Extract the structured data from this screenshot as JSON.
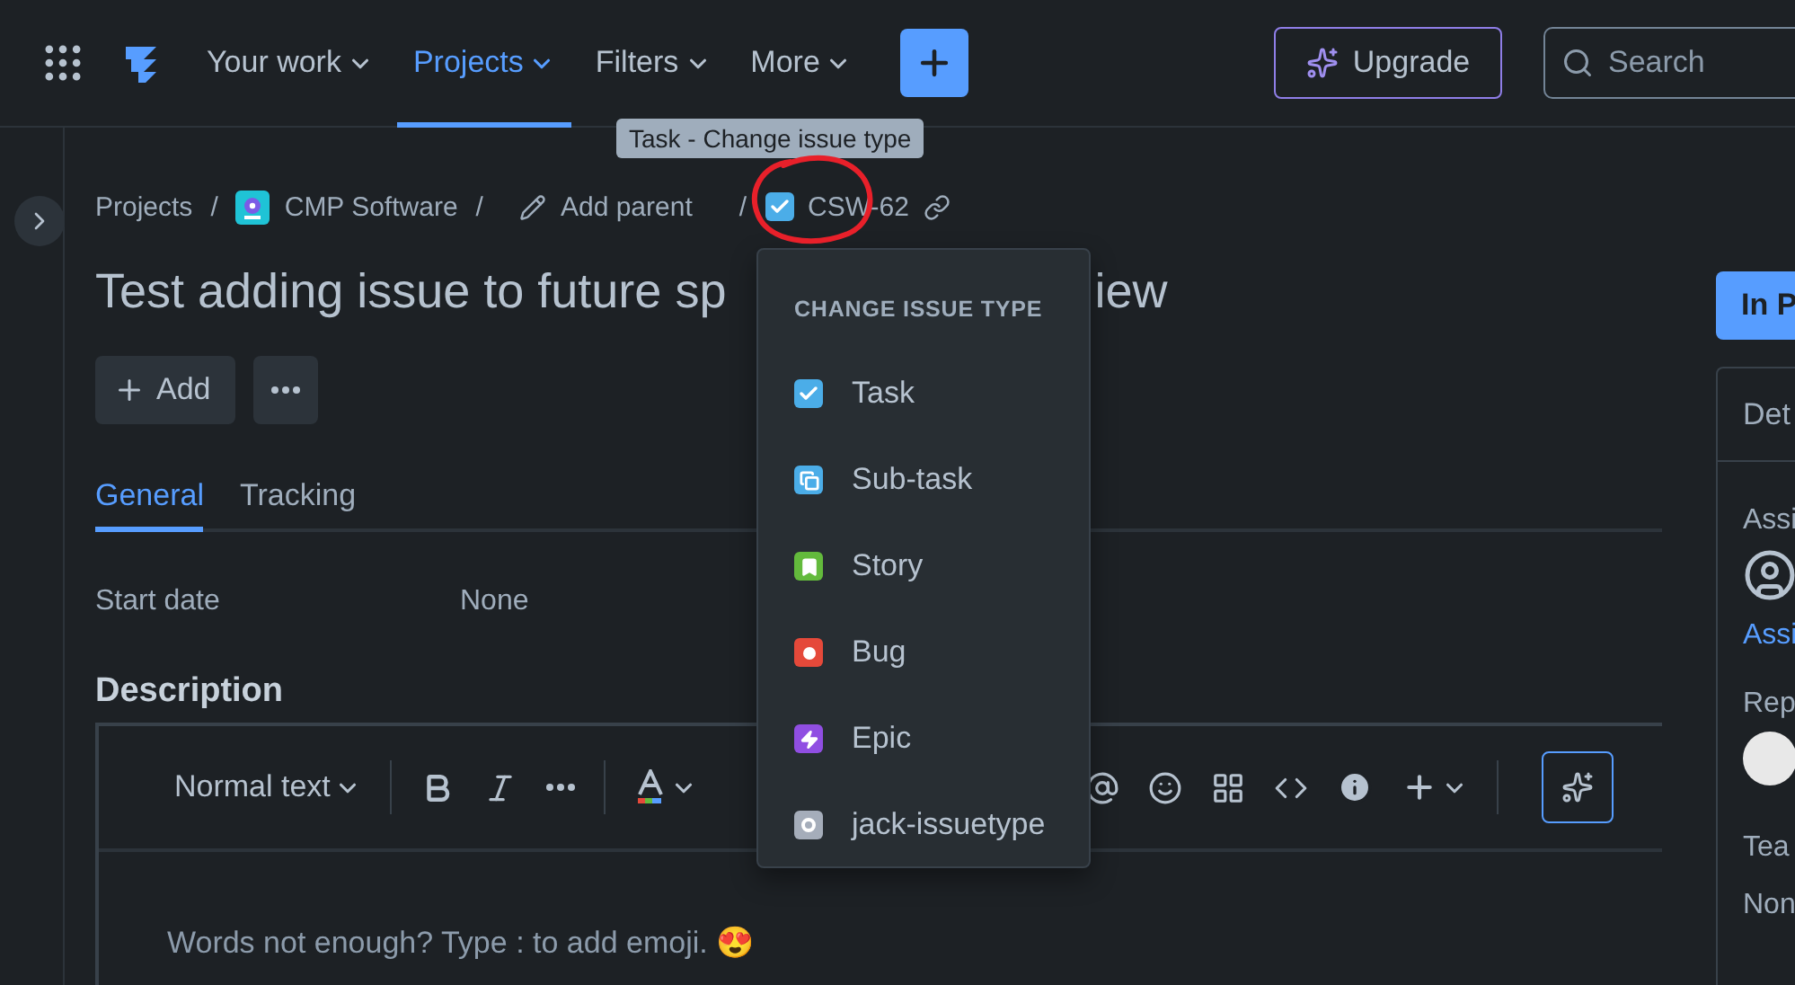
{
  "nav": {
    "items": [
      {
        "label": "Your work",
        "selected": false
      },
      {
        "label": "Projects",
        "selected": true
      },
      {
        "label": "Filters",
        "selected": false
      },
      {
        "label": "More",
        "selected": false
      }
    ],
    "upgrade": "Upgrade",
    "search": {
      "placeholder": "Search"
    }
  },
  "tooltip": "Task - Change issue type",
  "breadcrumbs": {
    "projects": "Projects",
    "project": "CMP Software",
    "add_parent": "Add parent",
    "issue_key": "CSW-62",
    "separators": [
      "/",
      "/",
      "/"
    ]
  },
  "title": {
    "start": "Test adding issue to future sp",
    "end": "iew"
  },
  "actions": {
    "add": "Add"
  },
  "tabs": [
    {
      "label": "General",
      "selected": true
    },
    {
      "label": "Tracking",
      "selected": false
    }
  ],
  "fields": [
    {
      "label": "Start date",
      "value": "None"
    }
  ],
  "description": {
    "heading": "Description",
    "text_style": "Normal text",
    "placeholder": "Words not enough? Type : to add emoji. 😍"
  },
  "issue_type_menu": {
    "heading": "CHANGE ISSUE TYPE",
    "items": [
      {
        "label": "Task",
        "kind": "task",
        "color": "#4bade8"
      },
      {
        "label": "Sub-task",
        "kind": "subtask",
        "color": "#4bade8"
      },
      {
        "label": "Story",
        "kind": "story",
        "color": "#63ba3c"
      },
      {
        "label": "Bug",
        "kind": "bug",
        "color": "#e5493a"
      },
      {
        "label": "Epic",
        "kind": "epic",
        "color": "#904ee2"
      },
      {
        "label": "jack-issuetype",
        "kind": "custom",
        "color": "#a5adba"
      }
    ]
  },
  "right_panel": {
    "status": "In P",
    "details": "Det",
    "assignee_label": "Assi",
    "assign_link": "Assi",
    "reporter_label": "Rep",
    "team_label": "Tea",
    "team_value": "Non"
  }
}
